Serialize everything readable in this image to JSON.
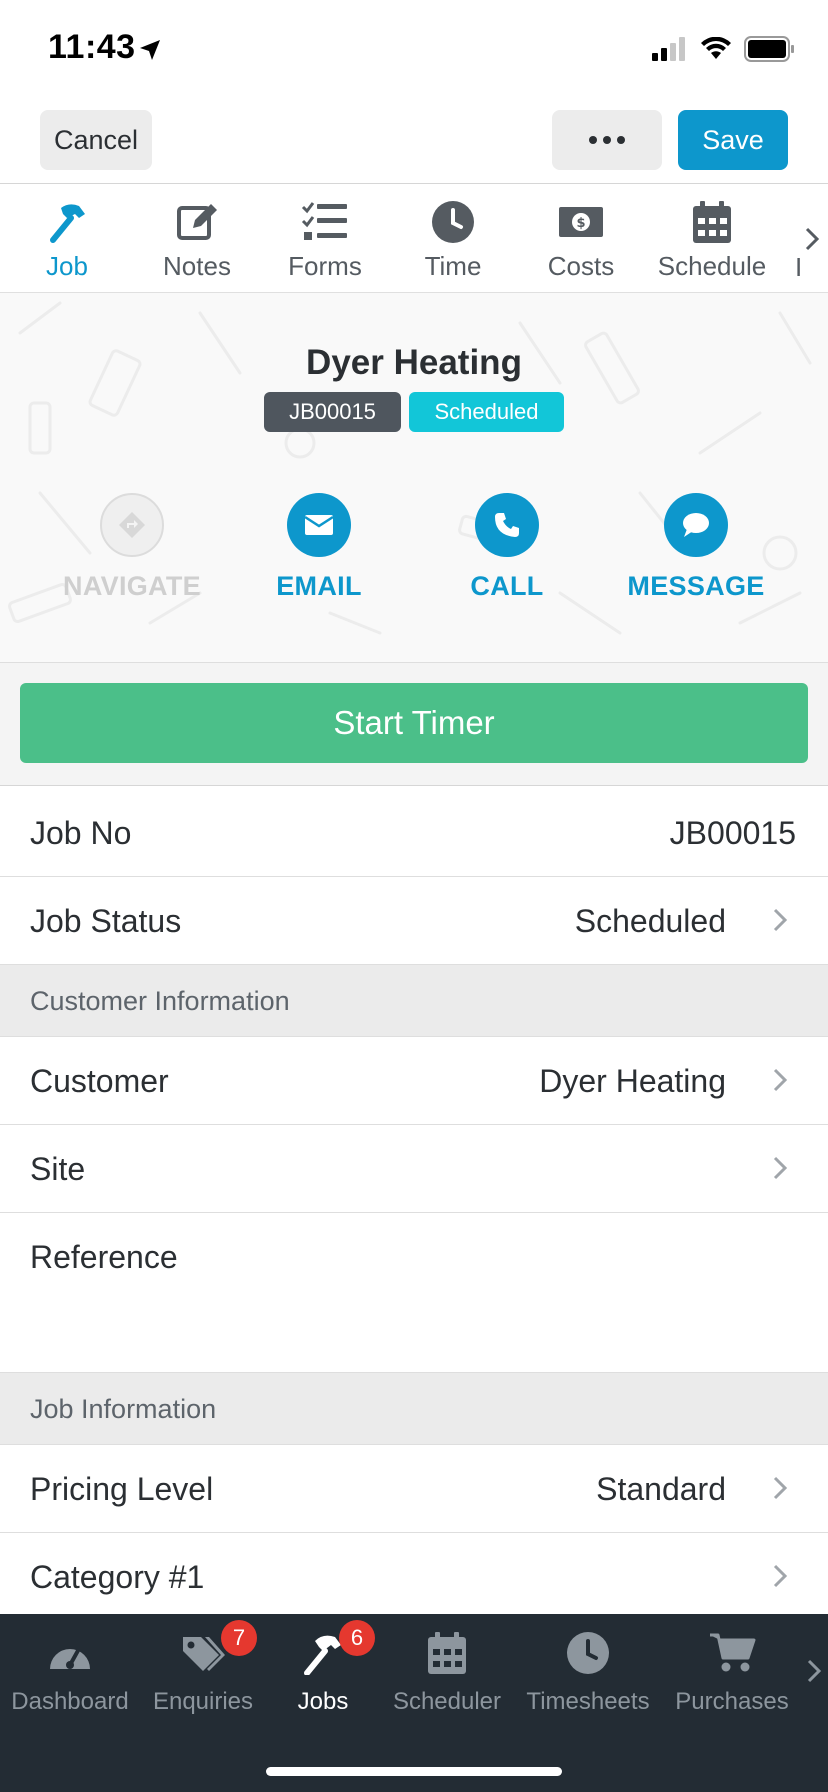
{
  "status_bar": {
    "time": "11:43"
  },
  "toolbar": {
    "cancel_label": "Cancel",
    "save_label": "Save"
  },
  "tabs": [
    {
      "label": "Job",
      "icon": "hammer-icon",
      "active": true
    },
    {
      "label": "Notes",
      "icon": "edit-note-icon",
      "active": false
    },
    {
      "label": "Forms",
      "icon": "checklist-icon",
      "active": false
    },
    {
      "label": "Time",
      "icon": "clock-icon",
      "active": false
    },
    {
      "label": "Costs",
      "icon": "money-icon",
      "active": false
    },
    {
      "label": "Schedule",
      "icon": "calendar-icon",
      "active": false
    }
  ],
  "tab_overflow_label": "I",
  "job": {
    "title": "Dyer Heating",
    "id": "JB00015",
    "status": "Scheduled"
  },
  "actions": [
    {
      "label": "NAVIGATE",
      "icon": "navigate-icon",
      "enabled": false
    },
    {
      "label": "EMAIL",
      "icon": "email-icon",
      "enabled": true
    },
    {
      "label": "CALL",
      "icon": "phone-icon",
      "enabled": true
    },
    {
      "label": "MESSAGE",
      "icon": "message-icon",
      "enabled": true
    }
  ],
  "timer_label": "Start Timer",
  "fields": {
    "job_no": {
      "label": "Job No",
      "value": "JB00015"
    },
    "job_status": {
      "label": "Job Status",
      "value": "Scheduled"
    },
    "customer_section": "Customer Information",
    "customer": {
      "label": "Customer",
      "value": "Dyer Heating"
    },
    "site": {
      "label": "Site",
      "value": ""
    },
    "reference": {
      "label": "Reference",
      "value": ""
    },
    "job_section": "Job Information",
    "pricing_level": {
      "label": "Pricing Level",
      "value": "Standard"
    },
    "category_1": {
      "label": "Category #1",
      "value": ""
    }
  },
  "bottom_nav": [
    {
      "label": "Dashboard",
      "icon": "speedometer-icon",
      "badge": "",
      "active": false
    },
    {
      "label": "Enquiries",
      "icon": "tags-icon",
      "badge": "7",
      "active": false
    },
    {
      "label": "Jobs",
      "icon": "hammer-icon",
      "badge": "6",
      "active": true
    },
    {
      "label": "Scheduler",
      "icon": "calendar-icon",
      "badge": "",
      "active": false
    },
    {
      "label": "Timesheets",
      "icon": "clock-icon",
      "badge": "",
      "active": false
    },
    {
      "label": "Purchases",
      "icon": "cart-icon",
      "badge": "",
      "active": false
    }
  ],
  "colors": {
    "accent": "#0d97cc",
    "timer_green": "#4bbf89",
    "status_cyan": "#12c6d8",
    "nav_bg": "#232c34",
    "badge_red": "#e5382f"
  }
}
